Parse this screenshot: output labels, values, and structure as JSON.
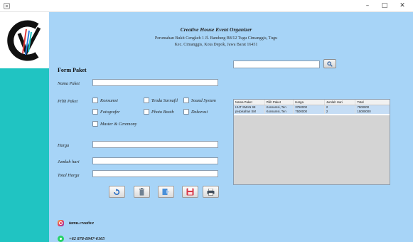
{
  "window": {
    "minimize": "–",
    "maximize": "□",
    "close": "✕"
  },
  "brand": {
    "logo_icon": "cv-logo-icon",
    "accent": "#20c4c2"
  },
  "header": {
    "company": "Creative House Event Organizer",
    "address_line1": "Perumahan Bukit Cengkeh 1 Jl. Bandung B8/12 Tugu Cimanggis, Tugu",
    "address_line2": "Kec. Cimanggis, Kota Depok, Jawa Barat 16451"
  },
  "form": {
    "title": "Form Paket",
    "nama_paket_label": "Nama Paket",
    "nama_paket_value": "",
    "pilih_paket_label": "Pilih Paket",
    "options": {
      "konsumsi": "Konsumsi",
      "tenda": "Tenda Sarnafil",
      "sound": "Sound System",
      "fotografer": "Fotografer",
      "photo_booth": "Photo Booth",
      "dekorasi": "Dekorasi",
      "master": "Master & Ceremony"
    },
    "harga_label": "Harga",
    "harga_value": "",
    "jumlah_hari_label": "Jumlah hari",
    "jumlah_hari_value": "",
    "total_harga_label": "Total Harga",
    "total_harga_value": ""
  },
  "search": {
    "value": "",
    "icon": "search-icon"
  },
  "table": {
    "columns": [
      "Nama Paket",
      "Pilih Paket",
      "Harga",
      "Jumlah Hari",
      "Total"
    ],
    "rows": [
      [
        "HUT SMAN 98",
        "Konsumsi, Ten",
        "3750000",
        "2",
        "7500000"
      ],
      [
        "perpisahan SM",
        "Konsumsi, Ten",
        "7500000",
        "2",
        "15000000"
      ]
    ]
  },
  "toolbar": {
    "refresh_icon": "refresh-icon",
    "delete_icon": "trash-icon",
    "edit_icon": "edit-icon",
    "save_icon": "save-icon",
    "print_icon": "print-icon"
  },
  "social": {
    "instagram": "tamu.creative",
    "whatsapp": "+62 878-8947-6165"
  },
  "colors": {
    "panel_blue": "#a7d4f7",
    "teal": "#20c4c2"
  }
}
